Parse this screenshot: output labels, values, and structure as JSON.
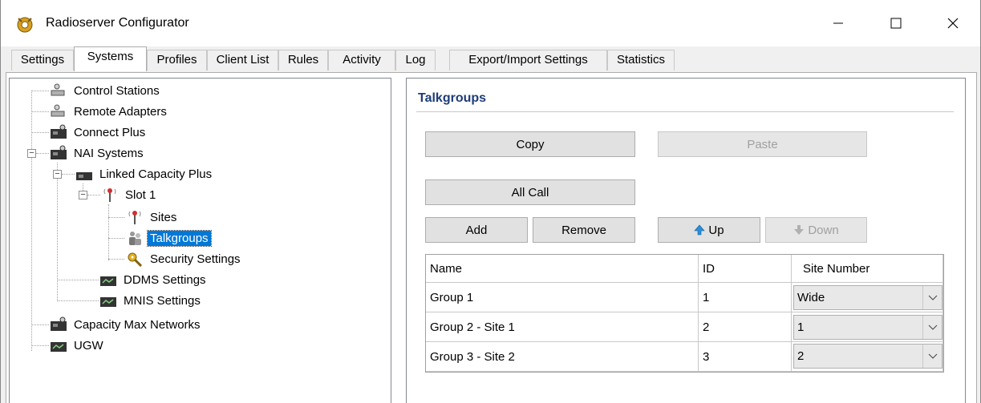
{
  "window": {
    "title": "Radioserver Configurator",
    "icon": "radioserver-app-icon"
  },
  "tabs": [
    {
      "label": "Settings",
      "active": false
    },
    {
      "label": "Systems",
      "active": true
    },
    {
      "label": "Profiles",
      "active": false
    },
    {
      "label": "Client List",
      "active": false
    },
    {
      "label": "Rules",
      "active": false
    },
    {
      "label": "Activity",
      "active": false
    },
    {
      "label": "Log",
      "active": false
    },
    {
      "label": "Export/Import Settings",
      "active": false
    },
    {
      "label": "Statistics",
      "active": false
    }
  ],
  "tree": {
    "items": [
      {
        "label": "Control Stations",
        "icon": "control-station-icon"
      },
      {
        "label": "Remote Adapters",
        "icon": "remote-adapter-icon"
      },
      {
        "label": "Connect Plus",
        "icon": "radio-system-icon"
      },
      {
        "label": "NAI Systems",
        "icon": "radio-system-icon",
        "expanded": true
      },
      {
        "label": "Linked Capacity Plus",
        "icon": "radio-system-icon",
        "expanded": true
      },
      {
        "label": "Slot 1",
        "icon": "antenna-icon",
        "expanded": true
      },
      {
        "label": "Sites",
        "icon": "antenna-icon"
      },
      {
        "label": "Talkgroups",
        "icon": "talkgroup-icon",
        "selected": true
      },
      {
        "label": "Security Settings",
        "icon": "key-icon"
      },
      {
        "label": "DDMS Settings",
        "icon": "settings-device-icon"
      },
      {
        "label": "MNIS Settings",
        "icon": "settings-device-icon"
      },
      {
        "label": "Capacity Max Networks",
        "icon": "radio-system-icon"
      },
      {
        "label": "UGW",
        "icon": "settings-device-icon"
      }
    ]
  },
  "panel": {
    "title": "Talkgroups",
    "buttons": {
      "copy": "Copy",
      "paste": "Paste",
      "all_call": "All Call",
      "add": "Add",
      "remove": "Remove",
      "up": "Up",
      "down": "Down"
    },
    "grid": {
      "columns": [
        "Name",
        "ID",
        "Site Number"
      ],
      "rows": [
        {
          "name": "Group 1",
          "id": "1",
          "site": "Wide"
        },
        {
          "name": "Group 2 - Site 1",
          "id": "2",
          "site": "1"
        },
        {
          "name": "Group 3 - Site 2",
          "id": "3",
          "site": "2"
        }
      ]
    }
  },
  "colors": {
    "selection": "#0078d7",
    "panel_title": "#1e3c78"
  }
}
